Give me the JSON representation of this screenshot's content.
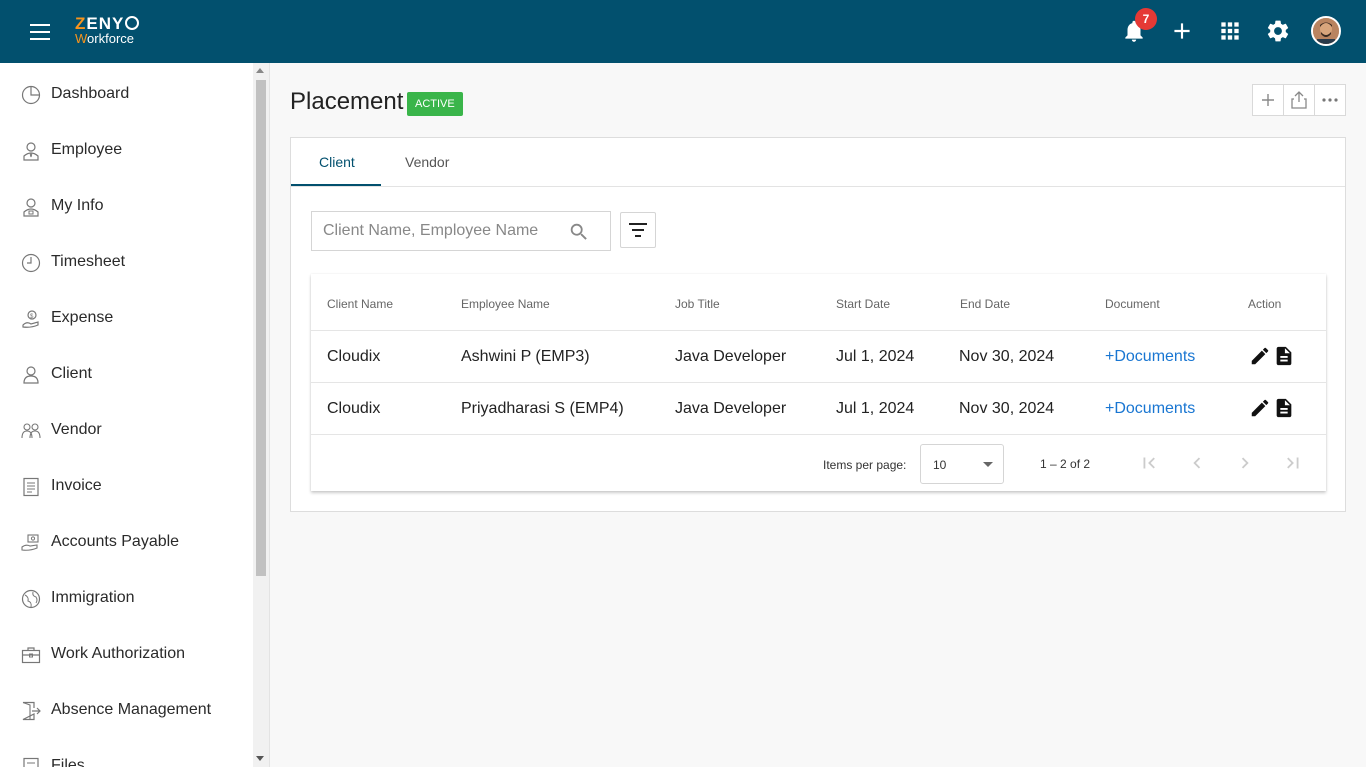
{
  "app": {
    "logo_text_main": "ZENY",
    "logo_text_sub": "Workforce",
    "notifications_count": "7",
    "accent_color": "#02506e",
    "icons": [
      "menu-icon",
      "bell-icon",
      "plus-icon",
      "apps-grid-icon",
      "gear-icon",
      "avatar"
    ]
  },
  "sidebar": {
    "items": [
      {
        "label": "Dashboard",
        "icon": "dashboard-icon"
      },
      {
        "label": "Employee",
        "icon": "employee-icon"
      },
      {
        "label": "My Info",
        "icon": "my-info-icon"
      },
      {
        "label": "Timesheet",
        "icon": "clock-icon"
      },
      {
        "label": "Expense",
        "icon": "expense-icon"
      },
      {
        "label": "Client",
        "icon": "client-icon"
      },
      {
        "label": "Vendor",
        "icon": "vendor-icon"
      },
      {
        "label": "Invoice",
        "icon": "invoice-icon"
      },
      {
        "label": "Accounts Payable",
        "icon": "accounts-payable-icon"
      },
      {
        "label": "Immigration",
        "icon": "globe-icon"
      },
      {
        "label": "Work Authorization",
        "icon": "briefcase-icon"
      },
      {
        "label": "Absence Management",
        "icon": "exit-door-icon"
      },
      {
        "label": "Files",
        "icon": "files-icon"
      }
    ]
  },
  "page": {
    "title": "Placement",
    "status": "ACTIVE",
    "status_color": "#3ab54a"
  },
  "tabs": [
    {
      "label": "Client",
      "active": true
    },
    {
      "label": "Vendor",
      "active": false
    }
  ],
  "search": {
    "placeholder": "Client Name, Employee Name",
    "value": ""
  },
  "table": {
    "columns": [
      "Client Name",
      "Employee Name",
      "Job Title",
      "Start Date",
      "End Date",
      "Document",
      "Action"
    ],
    "rows": [
      {
        "client": "Cloudix",
        "employee": "Ashwini P (EMP3)",
        "job": "Java Developer",
        "start": "Jul 1, 2024",
        "end": "Nov 30, 2024",
        "document": "+Documents"
      },
      {
        "client": "Cloudix",
        "employee": "Priyadharasi S (EMP4)",
        "job": "Java Developer",
        "start": "Jul 1, 2024",
        "end": "Nov 30, 2024",
        "document": "+Documents"
      }
    ]
  },
  "pagination": {
    "items_per_page_label": "Items per page:",
    "items_per_page_value": "10",
    "range_label": "1 – 2 of 2"
  }
}
